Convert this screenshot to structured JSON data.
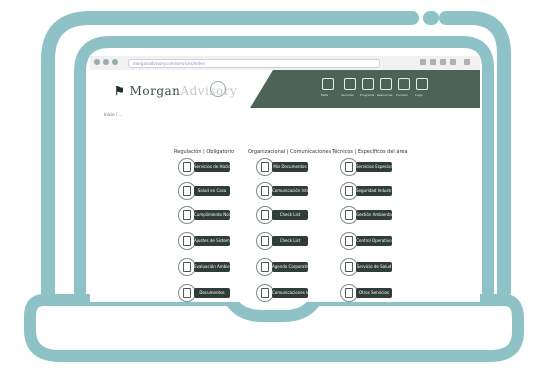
{
  "browser": {
    "url": "morganadvisory.com/services/index"
  },
  "header": {
    "logo_strong": "Morgan",
    "logo_fade": "Advisory",
    "icons": [
      {
        "name": "chart-icon",
        "caption": "Data"
      },
      {
        "name": "grid-icon",
        "caption": "Services"
      },
      {
        "name": "monitor-icon",
        "caption": "Programs"
      },
      {
        "name": "book-icon",
        "caption": "Resources"
      },
      {
        "name": "document-icon",
        "caption": "Contact"
      },
      {
        "name": "person-icon",
        "caption": "Login"
      }
    ]
  },
  "breadcrumb": "Inicio / ...",
  "columns": [
    {
      "heading": "Regulación | Obligatorio",
      "tiles": [
        {
          "label": "Servicios de Hacienda Pública"
        },
        {
          "label": "Salud en Casa"
        },
        {
          "label": "Cumplimiento Normativo"
        },
        {
          "label": "Ajustes de Sistema"
        },
        {
          "label": "Evaluación Ambiental"
        },
        {
          "label": "Documentos"
        }
      ]
    },
    {
      "heading": "Organizacional | Comunicaciones",
      "tiles": [
        {
          "label": "Mis Documentos"
        },
        {
          "label": "Comunicación Interna"
        },
        {
          "label": "Check List"
        },
        {
          "label": "Check List"
        },
        {
          "label": "Agenda Corporativa"
        },
        {
          "label": "Comunicaciones Internas"
        }
      ]
    },
    {
      "heading": "Técnicos | Específicos del área",
      "tiles": [
        {
          "label": "Servicios Especializados"
        },
        {
          "label": "Seguridad Industrial"
        },
        {
          "label": "Gestión Ambiental"
        },
        {
          "label": "Control Operativo"
        },
        {
          "label": "Servicio de Salud"
        },
        {
          "label": "Otros Servicios"
        }
      ]
    }
  ]
}
